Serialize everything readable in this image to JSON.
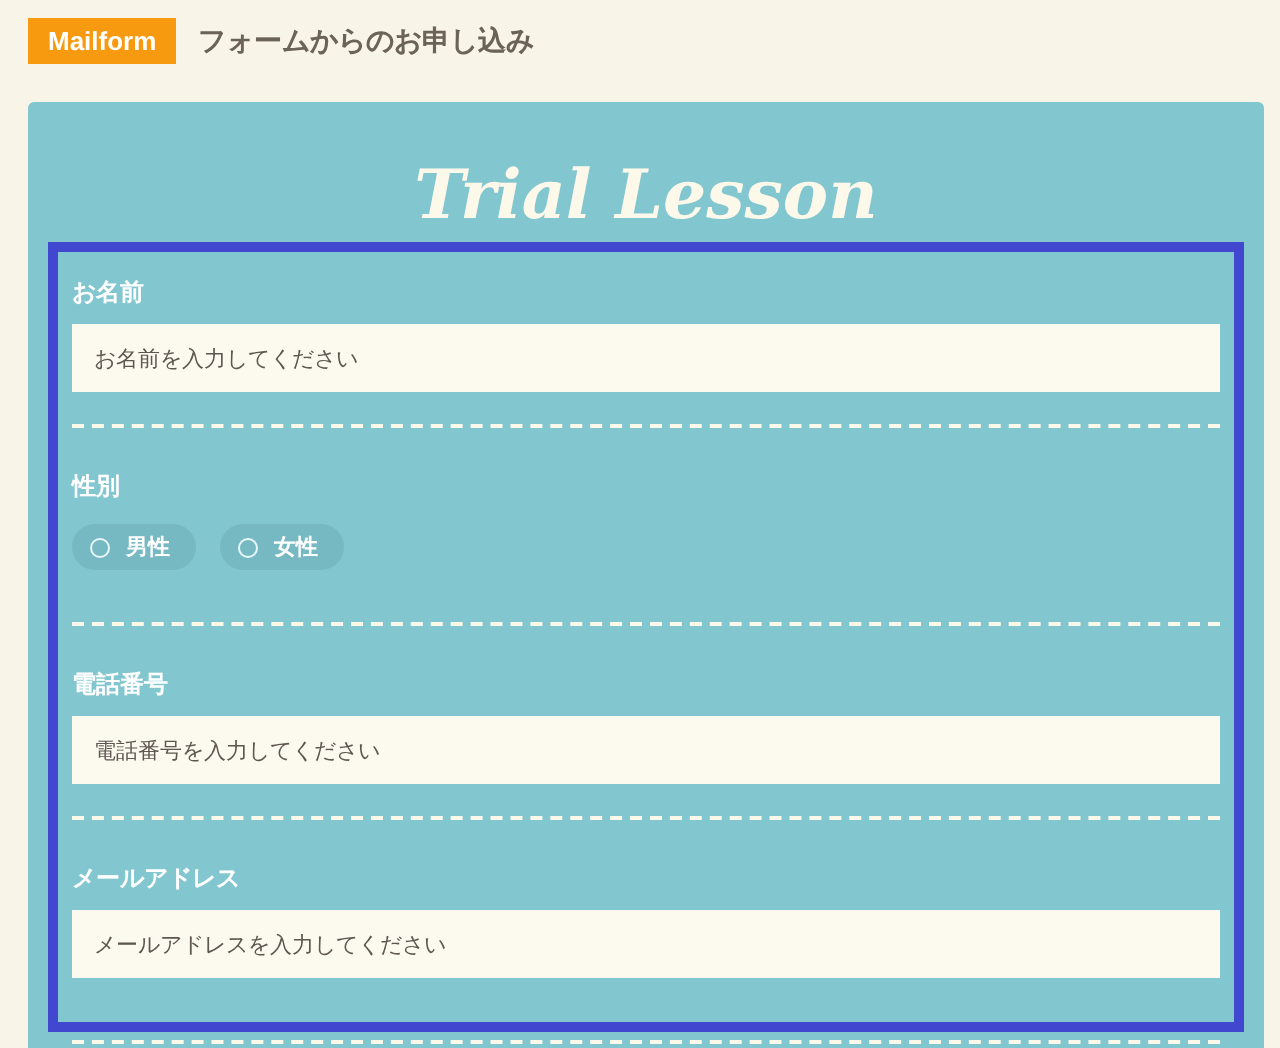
{
  "header": {
    "badge": "Mailform",
    "title": "フォームからのお申し込み"
  },
  "form": {
    "title": "Trial Lesson",
    "highlighted": true,
    "fields": [
      {
        "kind": "text",
        "label": "お名前",
        "placeholder": "お名前を入力してください"
      },
      {
        "kind": "radio",
        "label": "性別",
        "options": [
          {
            "label": "男性",
            "selected": false
          },
          {
            "label": "女性",
            "selected": false
          }
        ]
      },
      {
        "kind": "text",
        "label": "電話番号",
        "placeholder": "電話番号を入力してください"
      },
      {
        "kind": "text",
        "label": "メールアドレス",
        "placeholder": "メールアドレスを入力してください"
      }
    ]
  }
}
